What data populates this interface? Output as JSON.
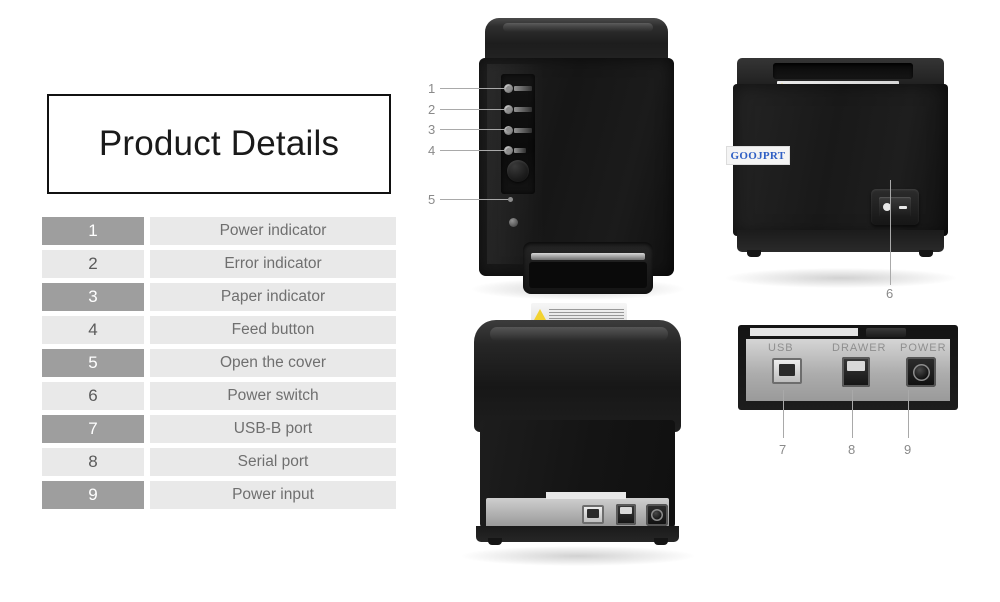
{
  "title": {
    "text": "Product Details"
  },
  "legend": {
    "rows": [
      {
        "num": "1",
        "label": "Power indicator"
      },
      {
        "num": "2",
        "label": "Error indicator"
      },
      {
        "num": "3",
        "label": "Paper indicator"
      },
      {
        "num": "4",
        "label": "Feed button"
      },
      {
        "num": "5",
        "label": "Open the cover"
      },
      {
        "num": "6",
        "label": "Power switch"
      },
      {
        "num": "7",
        "label": "USB-B port"
      },
      {
        "num": "8",
        "label": "Serial port"
      },
      {
        "num": "9",
        "label": "Power input"
      }
    ]
  },
  "callouts": {
    "front": [
      "1",
      "2",
      "3",
      "4",
      "5"
    ],
    "side": [
      "6"
    ],
    "ports": [
      "7",
      "8",
      "9"
    ]
  },
  "brand": {
    "name": "GOOJPRT"
  },
  "port_captions": {
    "usb": "USB",
    "serial": "DRAWER",
    "power": "POWER"
  },
  "colors": {
    "num_cell_dark": "#9e9e9e",
    "num_cell_light": "#e9e9e9",
    "label_cell": "#e9e9e9",
    "label_text": "#6f6f6f",
    "callout_text": "#8a8a8a",
    "brand_text": "#2f5fc4",
    "warning_triangle": "#f2d230",
    "background": "#ffffff"
  }
}
